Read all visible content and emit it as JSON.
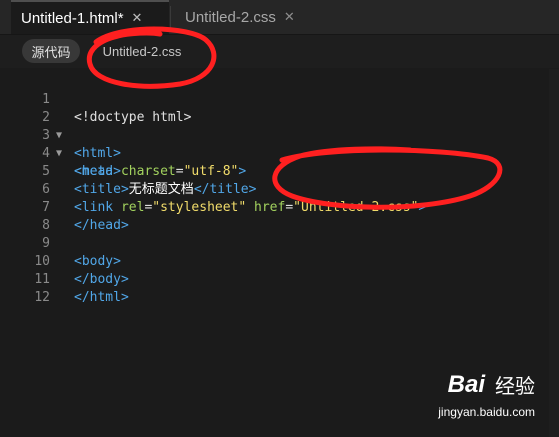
{
  "tabs": [
    {
      "label": "Untitled-1.html*",
      "close": "✕",
      "active": true
    },
    {
      "label": "Untitled-2.css",
      "close": "✕",
      "active": false
    }
  ],
  "subbar": {
    "source_label": "源代码",
    "related_file": "Untitled-2.css"
  },
  "code": {
    "lines": [
      {
        "n": "1",
        "fold": false
      },
      {
        "n": "2",
        "fold": true
      },
      {
        "n": "3",
        "fold": true
      },
      {
        "n": "4",
        "fold": false
      },
      {
        "n": "5",
        "fold": false
      },
      {
        "n": "6",
        "fold": false
      },
      {
        "n": "7",
        "fold": false
      },
      {
        "n": "8",
        "fold": false
      },
      {
        "n": "9",
        "fold": false
      },
      {
        "n": "10",
        "fold": false
      },
      {
        "n": "11",
        "fold": false
      },
      {
        "n": "12",
        "fold": false
      }
    ],
    "l1": "<!doctype html>",
    "l2": "<html>",
    "l3": "<head>",
    "l4": {
      "open": "<meta ",
      "attr": "charset",
      "eq": "=",
      "val": "\"utf-8\"",
      "close": ">"
    },
    "l5": {
      "open": "<title>",
      "text": "无标题文档",
      "close": "</title>"
    },
    "l6": {
      "open": "<link ",
      "attr1": "rel",
      "eq1": "=",
      "val1": "\"stylesheet\"",
      "sp": " ",
      "attr2": "href",
      "eq2": "=",
      "val2": "\"Untitled-2.css\"",
      "close": ">"
    },
    "l7": "</head>",
    "l9": "<body>",
    "l10": "</body>",
    "l11": "</html>"
  },
  "watermark": {
    "brand_a": "Bai",
    "brand_b": "经验",
    "url": "jingyan.baidu.com"
  },
  "colors": {
    "tag": "#51a7e8",
    "attr": "#a2d15e",
    "string": "#f1dc6b",
    "annotation": "#ff2020"
  }
}
